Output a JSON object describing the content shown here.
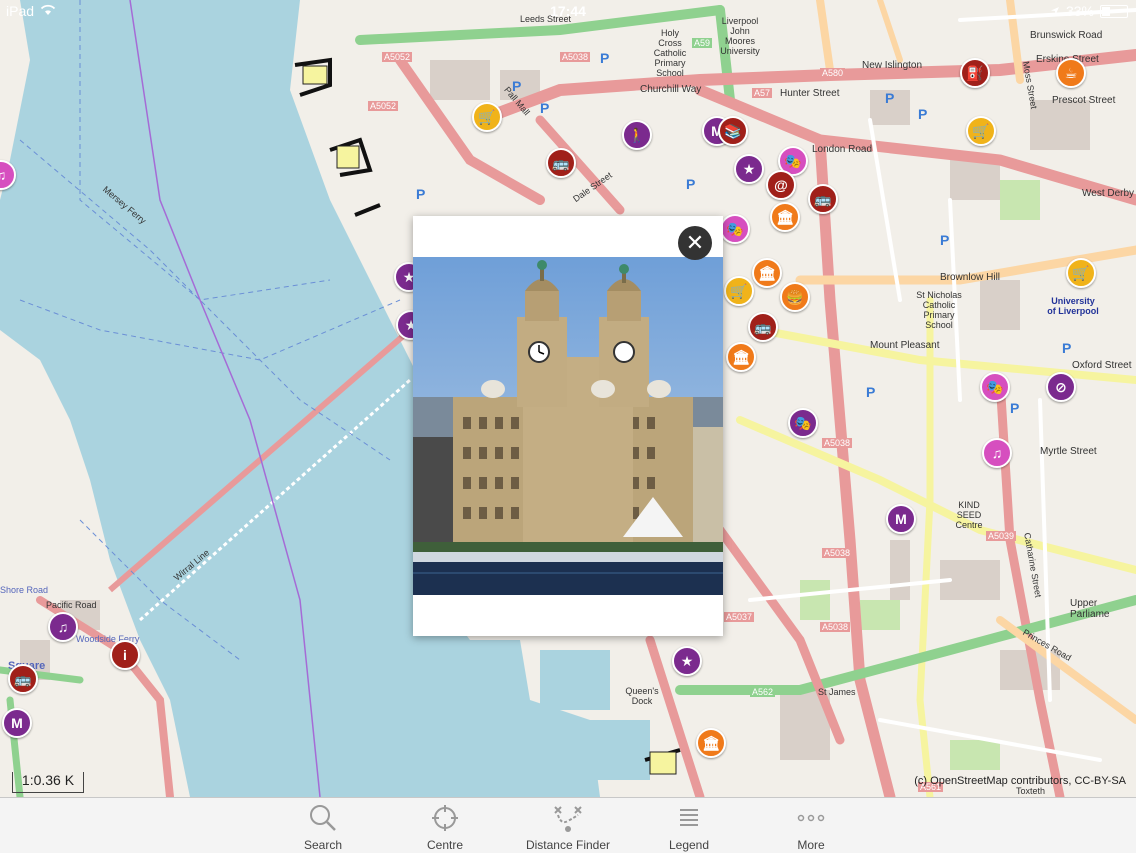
{
  "status_bar": {
    "device": "iPad",
    "time": "17:44",
    "battery": "33%"
  },
  "map": {
    "labels": {
      "leeds_street": "Leeds Street",
      "a5052_a": "A5052",
      "a5052_b": "A5052",
      "a5038_top": "A5038",
      "a59": "A59",
      "a580": "A580",
      "a57": "A57",
      "new_islington": "New Islington",
      "churchill_way": "Churchill Way",
      "hunter_street": "Hunter Street",
      "prescot_street": "Prescot Street",
      "erskine_street": "Erskine Street",
      "brunswick_road": "Brunswick Road",
      "london_road": "London Road",
      "west_derby": "West Derby",
      "brownlow_hill": "Brownlow Hill",
      "mount_pleasant": "Mount Pleasant",
      "oxford_street": "Oxford Street",
      "myrtle_street": "Myrtle Street",
      "liverpool_jmu": "Liverpool John Moores University",
      "holy_cross": "Holy Cross Catholic Primary School",
      "st_nicholas": "St Nicholas Catholic Primary School",
      "university_liverpool": "University of Liverpool",
      "a5038_mid": "A5038",
      "a5038_low": "A5038",
      "a5039": "A5039",
      "a5037": "A5037",
      "a562": "A562",
      "st_james": "St James",
      "a561": "A561",
      "kind_seed": "KIND SEED Centre",
      "queens_dock": "Queen's Dock",
      "mersey_ferry": "Mersey Ferry",
      "wirral_line": "Wirral Line",
      "woodside_ferry": "Woodside Ferry",
      "shore_road": "Shore Road",
      "pacific_road": "Pacific Road",
      "square": "Square",
      "princes_road": "Princes Road",
      "upper_parliament": "Upper Parliame",
      "catharine_street": "Catharine Street",
      "toxteth": "Toxteth",
      "dale_street": "Dale Street",
      "pall_mall": "Pall Mall",
      "moss_street": "Moss Street",
      "dansie_street": "Dansie Street"
    },
    "scale": "1:0.36 K",
    "attribution": "(c) OpenStreetMap contributors, CC-BY-SA"
  },
  "popup": {
    "close_symbol": "✕"
  },
  "toolbar": {
    "search": "Search",
    "centre": "Centre",
    "distance_finder": "Distance Finder",
    "legend": "Legend",
    "more": "More"
  }
}
